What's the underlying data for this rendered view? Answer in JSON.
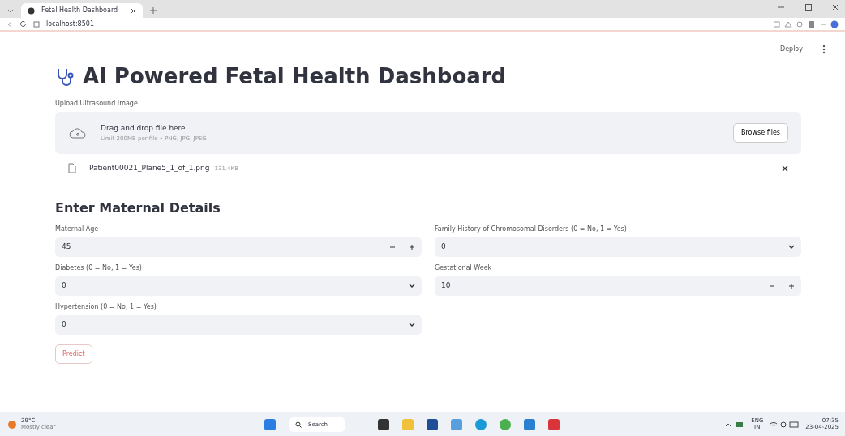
{
  "browser": {
    "tab_title": "Fetal Health Dashboard",
    "address": "localhost:8501"
  },
  "app_header": {
    "deploy": "Deploy"
  },
  "title": "AI Powered Fetal Health Dashboard",
  "uploader": {
    "label": "Upload Ultrasound Image",
    "drop_text": "Drag and drop file here",
    "limit_text": "Limit 200MB per file • PNG, JPG, JPEG",
    "browse_button": "Browse files",
    "file": {
      "name": "Patient00021_Plane5_1_of_1.png",
      "size": "131.4KB"
    }
  },
  "section_heading": "Enter Maternal Details",
  "columns": [
    [
      {
        "kind": "number",
        "label": "Maternal Age",
        "value": "45"
      },
      {
        "kind": "select",
        "label": "Diabetes (0 = No, 1 = Yes)",
        "value": "0"
      },
      {
        "kind": "select",
        "label": "Hypertension (0 = No, 1 = Yes)",
        "value": "0"
      }
    ],
    [
      {
        "kind": "select",
        "label": "Family History of Chromosomal Disorders (0 = No, 1 = Yes)",
        "value": "0"
      },
      {
        "kind": "number",
        "label": "Gestational Week",
        "value": "10"
      }
    ]
  ],
  "predict_button": "Predict",
  "taskbar": {
    "weather_temp": "29°C",
    "weather_text": "Mostly clear",
    "search": "Search",
    "lang": "ENG",
    "region": "IN",
    "time": "07:35",
    "date": "23-04-2025"
  }
}
